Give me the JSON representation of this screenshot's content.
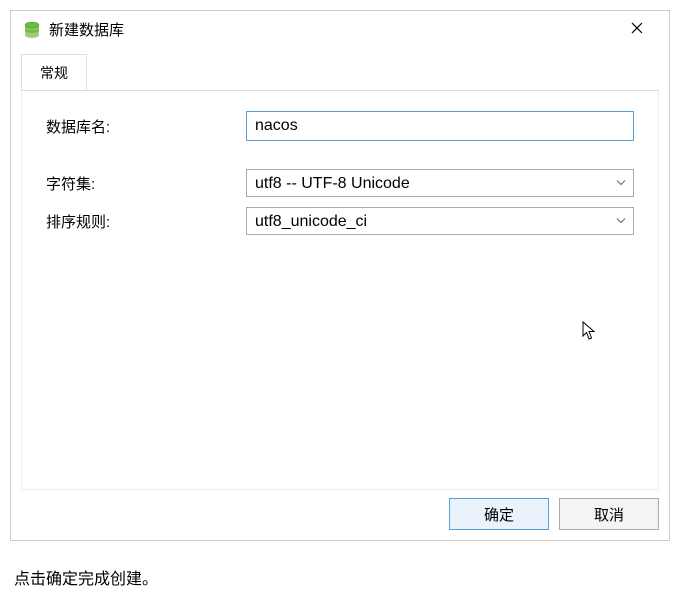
{
  "dialog": {
    "title": "新建数据库",
    "tabs": {
      "general": "常规"
    },
    "fields": {
      "dbname_label": "数据库名:",
      "dbname_value": "nacos",
      "charset_label": "字符集:",
      "charset_value": "utf8 -- UTF-8 Unicode",
      "collation_label": "排序规则:",
      "collation_value": "utf8_unicode_ci"
    },
    "buttons": {
      "ok": "确定",
      "cancel": "取消"
    }
  },
  "caption": "点击确定完成创建。"
}
